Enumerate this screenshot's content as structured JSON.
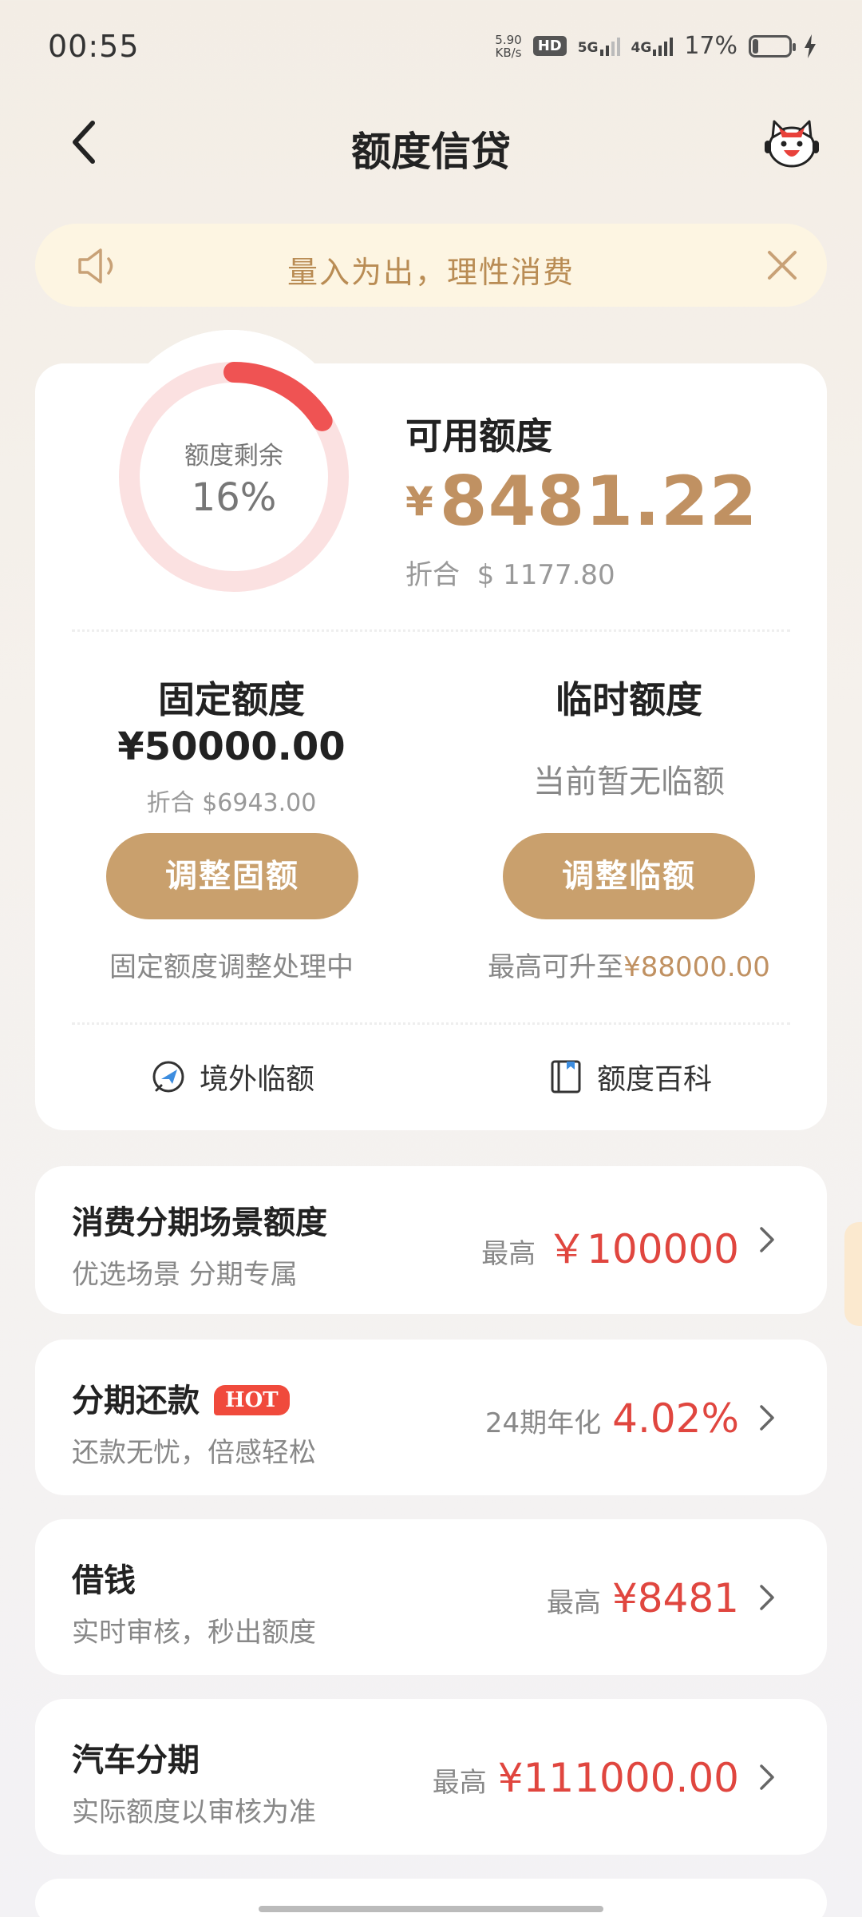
{
  "status_bar": {
    "time": "00:55",
    "net_speed_value": "5.90",
    "net_speed_unit": "KB/s",
    "hd_label": "HD",
    "sim1_label": "5G",
    "sim2_label": "4G",
    "battery_percent": "17%",
    "battery_level": 0.17,
    "charging": true
  },
  "header": {
    "title": "额度信贷",
    "back_icon": "chevron-left-icon",
    "assistant_icon": "mascot-icon"
  },
  "notice": {
    "text": "量入为出，理性消费",
    "speaker_icon": "speaker-icon",
    "close_icon": "close-icon"
  },
  "credit": {
    "ring_label": "额度剩余",
    "ring_percent": "16%",
    "ring_fraction": 0.16,
    "available_label": "可用额度",
    "currency_symbol": "¥",
    "available_amount": "8481.22",
    "equiv_prefix": "折合",
    "equiv_amount": "$ 1177.80",
    "fixed": {
      "title": "固定额度",
      "amount": "¥50000.00",
      "equiv": "折合 $6943.00",
      "button": "调整固额",
      "note": "固定额度调整处理中"
    },
    "temporary": {
      "title": "临时额度",
      "none_text": "当前暂无临额",
      "button": "调整临额",
      "note_prefix": "最高可升至",
      "note_value": "¥88000.00"
    },
    "links": [
      {
        "label": "境外临额",
        "icon": "plane-globe-icon"
      },
      {
        "label": "额度百科",
        "icon": "book-icon"
      }
    ]
  },
  "products": [
    {
      "title": "消费分期场景额度",
      "subtitle": "优选场景 分期专属",
      "prefix": "最高",
      "value": "￥100000"
    },
    {
      "title": "分期还款",
      "badge": "HOT",
      "subtitle": "还款无忧，倍感轻松",
      "prefix": "24期年化",
      "value": "4.02%"
    },
    {
      "title": "借钱",
      "subtitle": "实时审核，秒出额度",
      "prefix": "最高",
      "value": "¥8481"
    },
    {
      "title": "汽车分期",
      "subtitle": "实际额度以审核为准",
      "prefix": "最高",
      "value": "¥111000.00"
    }
  ],
  "colors": {
    "gold": "#c09162",
    "button_gold": "#c9a06d",
    "red": "#e0463f",
    "ring_track": "#fbe1e1",
    "ring_arc": "#ef5353"
  }
}
